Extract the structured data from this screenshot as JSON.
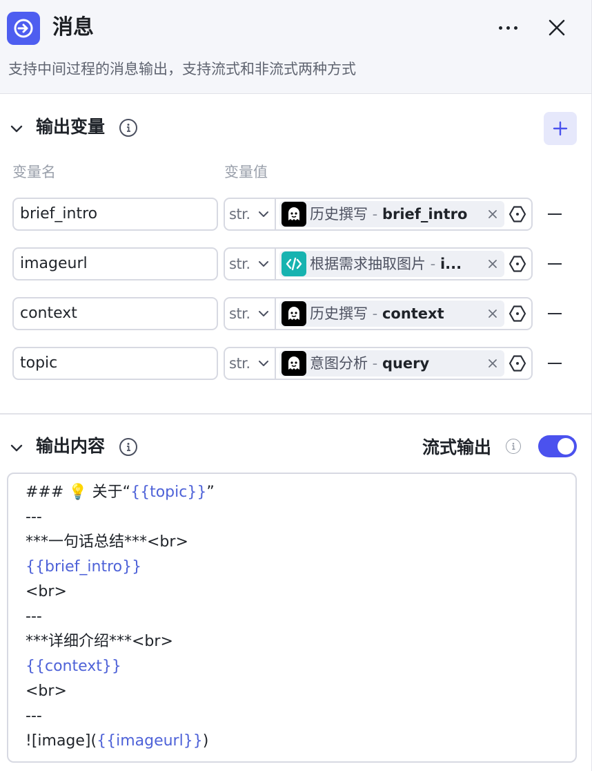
{
  "header": {
    "title": "消息",
    "description": "支持中间过程的消息输出，支持流式和非流式两种方式"
  },
  "output_variables": {
    "title": "输出变量",
    "col_name": "变量名",
    "col_value": "变量值",
    "rows": [
      {
        "name": "brief_intro",
        "type": "str.",
        "ref_icon": "ghost-icon",
        "ref_source": "历史撰写",
        "ref_sep": " - ",
        "ref_var": "brief_intro"
      },
      {
        "name": "imageurl",
        "type": "str.",
        "ref_icon": "code-icon",
        "ref_source": "根据需求抽取图片",
        "ref_sep": " - ",
        "ref_var": "i..."
      },
      {
        "name": "context",
        "type": "str.",
        "ref_icon": "ghost-icon",
        "ref_source": "历史撰写",
        "ref_sep": " - ",
        "ref_var": "context"
      },
      {
        "name": "topic",
        "type": "str.",
        "ref_icon": "ghost-icon",
        "ref_source": "意图分析",
        "ref_sep": " - ",
        "ref_var": "query"
      }
    ]
  },
  "output_content": {
    "title": "输出内容",
    "stream_label": "流式输出",
    "stream_enabled": true,
    "lines": [
      [
        {
          "t": "### 💡 关于“"
        },
        {
          "t": "{{topic}}",
          "tpl": true
        },
        {
          "t": "”"
        }
      ],
      [
        {
          "t": "---"
        }
      ],
      [
        {
          "t": "***一句话总结***<br>"
        }
      ],
      [
        {
          "t": "{{brief_intro}}",
          "tpl": true
        }
      ],
      [
        {
          "t": "<br>"
        }
      ],
      [
        {
          "t": "---"
        }
      ],
      [
        {
          "t": "***详细介绍***<br>"
        }
      ],
      [
        {
          "t": "{{context}}",
          "tpl": true
        }
      ],
      [
        {
          "t": "<br>"
        }
      ],
      [
        {
          "t": "---"
        }
      ],
      [
        {
          "t": "![image]("
        },
        {
          "t": "{{imageurl}}",
          "tpl": true
        },
        {
          "t": ")"
        }
      ]
    ]
  },
  "colors": {
    "accent": "#4b52ee",
    "node_icon_bg": "#4e5ef0",
    "code_icon_bg": "#17b3b0",
    "template_var": "#4e62d8"
  }
}
